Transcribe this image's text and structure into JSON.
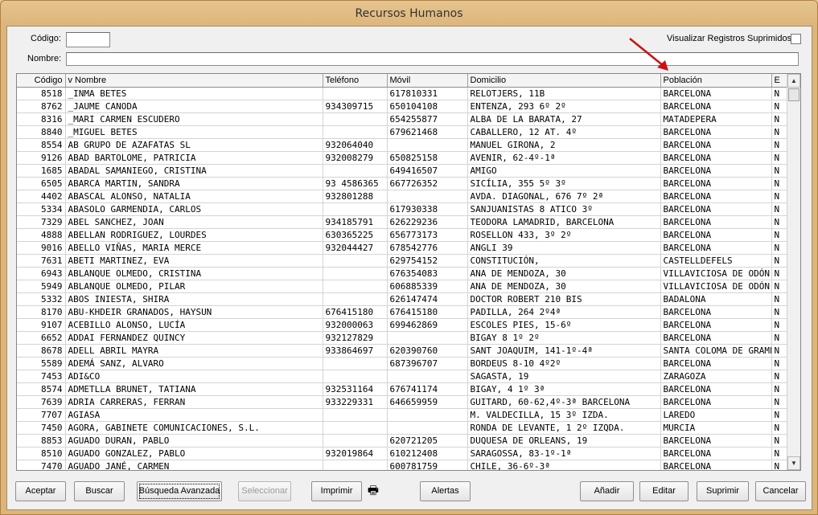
{
  "window": {
    "title": "Recursos Humanos"
  },
  "filters": {
    "codigo_label": "Código:",
    "codigo_value": "",
    "nombre_label": "Nombre:",
    "nombre_value": "",
    "suprimidos_label": "Visualizar Registros Suprimidos:",
    "suprimidos_checked": false
  },
  "colors": {
    "arrow": "#cc1111",
    "title_bar": "#e0bc85"
  },
  "table": {
    "columns": [
      "Código",
      "v Nombre",
      "Teléfono",
      "Móvil",
      "Domicilio",
      "Población",
      "E"
    ],
    "rows": [
      [
        "8518",
        "_INMA BETES",
        "",
        "617810331",
        "RELOTJERS, 11B",
        "BARCELONA",
        "N"
      ],
      [
        "8762",
        "_JAUME CANODA",
        "934309715",
        "650104108",
        "ENTENZA, 293 6º 2º",
        "BARCELONA",
        "N"
      ],
      [
        "8316",
        "_MARI CARMEN ESCUDERO",
        "",
        "654255877",
        "ALBA DE LA BARATA, 27",
        "MATADEPERA",
        "N"
      ],
      [
        "8840",
        "_MIGUEL BETES",
        "",
        "679621468",
        "CABALLERO, 12  AT. 4º",
        "BARCELONA",
        "N"
      ],
      [
        "8554",
        "AB GRUPO DE AZAFATAS SL",
        "932064040",
        "",
        "MANUEL GIRONA, 2",
        "BARCELONA",
        "N"
      ],
      [
        "9126",
        "ABAD BARTOLOME, PATRICIA",
        "932008279",
        "650825158",
        "AVENIR, 62-4º-1ª",
        "BARCELONA",
        "N"
      ],
      [
        "1685",
        "ABADAL SAMANIEGO, CRISTINA",
        "",
        "649416507",
        "AMIGO",
        "BARCELONA",
        "N"
      ],
      [
        "6505",
        "ABARCA MARTIN, SANDRA",
        "93 4586365",
        "667726352",
        "SICÍLIA, 355 5º 3º",
        "BARCELONA",
        "N"
      ],
      [
        "4402",
        "ABASCAL ALONSO, NATALIA",
        "932801288",
        "",
        "AVDA. DIAGONAL, 676  7º 2ª",
        "BARCELONA",
        "N"
      ],
      [
        "5334",
        "ABASOLO GARMENDIA, CARLOS",
        "",
        "617930338",
        "SANJUANISTAS 8 ATICO 3º",
        "BARCELONA",
        "N"
      ],
      [
        "7329",
        "ABEL SANCHEZ, JOAN",
        "934185791",
        "626229236",
        "TEODORA LAMADRID,  BARCELONA",
        "BARCELONA",
        "N"
      ],
      [
        "4888",
        "ABELLAN RODRIGUEZ, LOURDES",
        "630365225",
        "656773173",
        "ROSELLON 433, 3º 2º",
        "BARCELONA",
        "N"
      ],
      [
        "9016",
        "ABELLO VIÑAS, MARIA MERCE",
        "932044427",
        "678542776",
        "ANGLI 39",
        "BARCELONA",
        "N"
      ],
      [
        "7631",
        "ABETI MARTINEZ, EVA",
        "",
        "629754152",
        "CONSTITUCIÓN,",
        "CASTELLDEFELS",
        "N"
      ],
      [
        "6943",
        "ABLANQUE OLMEDO, CRISTINA",
        "",
        "676354083",
        "ANA DE MENDOZA, 30",
        "VILLAVICIOSA DE ODÓN",
        "N"
      ],
      [
        "5949",
        "ABLANQUE OLMEDO, PILAR",
        "",
        "606885339",
        "ANA DE MENDOZA, 30",
        "VILLAVICIOSA DE ODÓN",
        "N"
      ],
      [
        "5332",
        "ABOS INIESTA, SHIRA",
        "",
        "626147474",
        "DOCTOR ROBERT 210 BIS",
        "BADALONA",
        "N"
      ],
      [
        "8170",
        "ABU-KHDEIR GRANADOS, HAYSUN",
        "676415180",
        "676415180",
        "PADILLA, 264   2º4ª",
        "BARCELONA",
        "N"
      ],
      [
        "9107",
        "ACEBILLO ALONSO, LUCÍA",
        "932000063",
        "699462869",
        "ESCOLES PIES, 15-6º",
        "BARCELONA",
        "N"
      ],
      [
        "6652",
        "ADDAI FERNANDEZ QUINCY",
        "932127829",
        "",
        "BIGAY 8 1º 2º",
        "BARCELONA",
        "N"
      ],
      [
        "8678",
        "ADELL ABRIL MAYRA",
        "933864697",
        "620390760",
        "SANT JOAQUIM, 141-1º-4ª",
        "SANTA COLOMA DE GRAMENET",
        "N"
      ],
      [
        "5589",
        "ADEMÁ SANZ, ALVARO",
        "",
        "687396707",
        "BORDEUS 8-10  4º2º",
        "BARCELONA",
        "N"
      ],
      [
        "7453",
        "ADI&CO",
        "",
        "",
        "SAGASTA, 19",
        "ZARAGOZA",
        "N"
      ],
      [
        "8574",
        "ADMETLLA BRUNET, TATIANA",
        "932531164",
        "676741174",
        "BIGAY, 4 1º 3ª",
        "BARCELONA",
        "N"
      ],
      [
        "7639",
        "ADRIA CARRERAS, FERRAN",
        "933229331",
        "646659959",
        "GUITARD, 60-62,4º-3ª BARCELONA",
        "BARCELONA",
        "N"
      ],
      [
        "7707",
        "AGIASA",
        "",
        "",
        "M. VALDECILLA, 15 3º IZDA.",
        "LAREDO",
        "N"
      ],
      [
        "7450",
        "AGORA, GABINETE COMUNICACIONES, S.L.",
        "",
        "",
        "RONDA DE LEVANTE, 1 2º IZQDA.",
        "MURCIA",
        "N"
      ],
      [
        "8853",
        "AGUADO DURAN, PABLO",
        "",
        "620721205",
        "DUQUESA DE ORLEANS, 19",
        "BARCELONA",
        "N"
      ],
      [
        "8510",
        "AGUADO GONZALEZ, PABLO",
        "932019864",
        "610212408",
        "SARAGOSSA, 83-1º-1ª",
        "BARCELONA",
        "N"
      ],
      [
        "7470",
        "AGUADO JANÉ, CARMEN",
        "",
        "600781759",
        "CHILE, 36-6º-3ª",
        "BARCELONA",
        "N"
      ]
    ]
  },
  "buttons": {
    "aceptar": "Aceptar",
    "buscar": "Buscar",
    "busqueda_avanzada": "Búsqueda Avanzada",
    "seleccionar": "Seleccionar",
    "imprimir": "Imprimir",
    "alertas": "Alertas",
    "anadir": "Añadir",
    "editar": "Editar",
    "suprimir": "Suprimir",
    "cancelar": "Cancelar"
  },
  "icons": {
    "printer": "printer-icon",
    "scroll_up": "scroll-up-icon",
    "scroll_down": "scroll-down-icon"
  }
}
